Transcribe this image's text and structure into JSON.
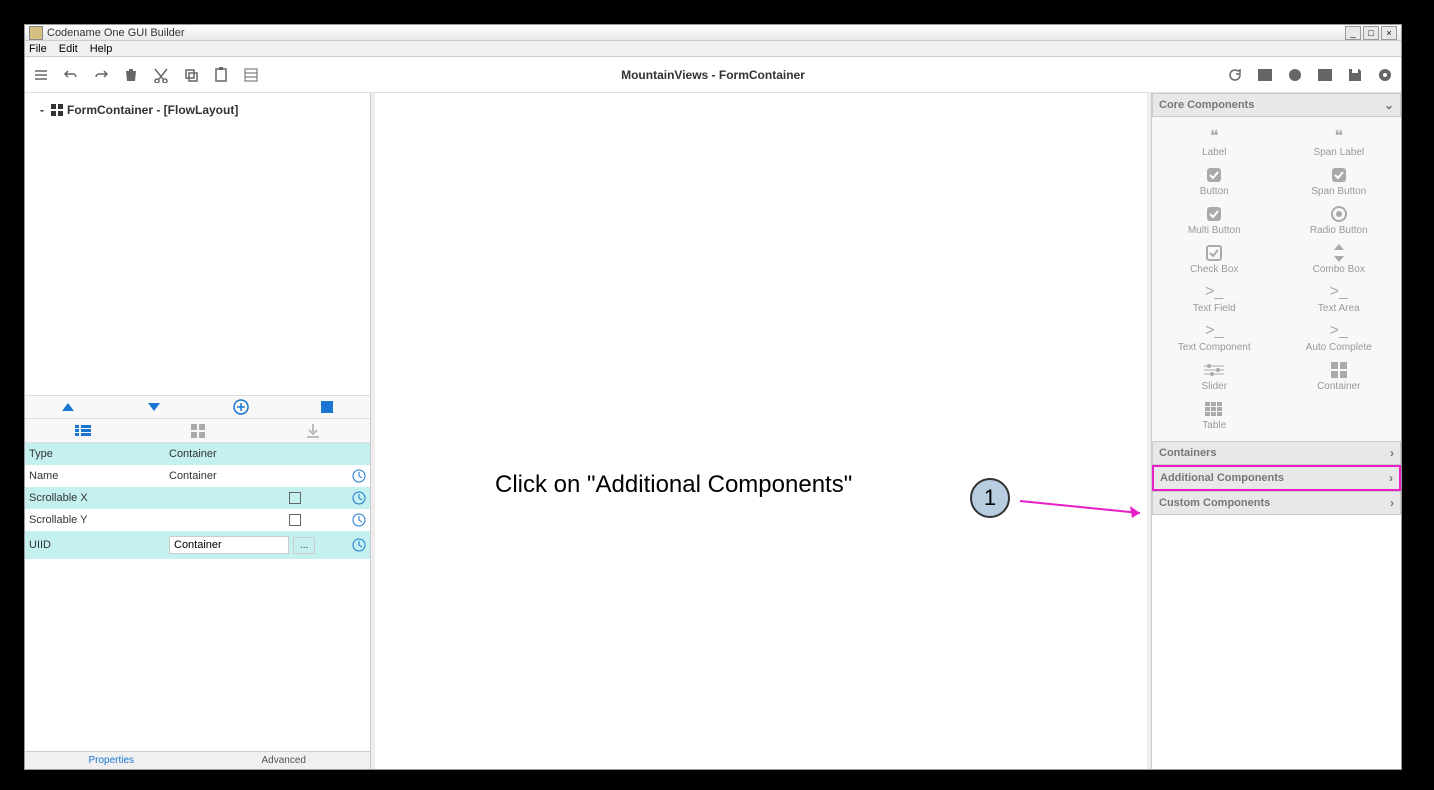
{
  "titlebar": {
    "title": "Codename One GUI Builder"
  },
  "menubar": {
    "file": "File",
    "edit": "Edit",
    "help": "Help"
  },
  "toolbar": {
    "center_title": "MountainViews - FormContainer"
  },
  "tree": {
    "root": "FormContainer - [FlowLayout]"
  },
  "props": {
    "type_label": "Type",
    "type_value": "Container",
    "name_label": "Name",
    "name_value": "Container",
    "scrollx_label": "Scrollable X",
    "scrolly_label": "Scrollable Y",
    "uiid_label": "UIID",
    "uiid_value": "Container",
    "ellipsis": "..."
  },
  "bottom_tabs": {
    "properties": "Properties",
    "advanced": "Advanced"
  },
  "annotation": {
    "text": "Click on \"Additional Components\"",
    "number": "1"
  },
  "right_panel": {
    "core_header": "Core Components",
    "containers_header": "Containers",
    "additional_header": "Additional Components",
    "custom_header": "Custom Components",
    "components": {
      "label": "Label",
      "span_label": "Span Label",
      "button": "Button",
      "span_button": "Span Button",
      "multi_button": "Multi Button",
      "radio_button": "Radio Button",
      "check_box": "Check Box",
      "combo_box": "Combo Box",
      "text_field": "Text Field",
      "text_area": "Text Area",
      "text_component": "Text Component",
      "auto_complete": "Auto Complete",
      "slider": "Slider",
      "container": "Container",
      "table": "Table"
    }
  }
}
